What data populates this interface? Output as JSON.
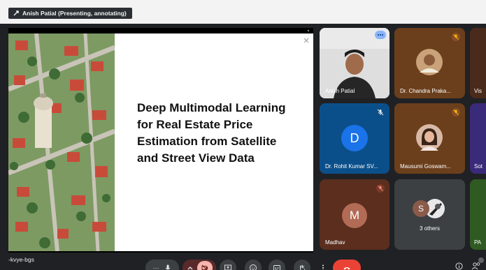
{
  "presenter": {
    "label": "Anish Patial (Presenting, annotating)"
  },
  "slide": {
    "title_lines": [
      "Deep Multimodal Learning",
      "for Real Estate Price",
      "Estimation from Satellite",
      "and Street View Data"
    ]
  },
  "participants": [
    {
      "name": "Anish Patial",
      "muted": false
    },
    {
      "name": "Dr. Chandra Praka...",
      "muted": true
    },
    {
      "name": "Vis",
      "muted": false
    },
    {
      "name": "Dr. Rohit Kumar SV...",
      "initial": "D",
      "muted": true
    },
    {
      "name": "Mausumi Goswam...",
      "muted": true
    },
    {
      "name": "Sot",
      "muted": false
    },
    {
      "name": "Madhav",
      "initial": "M",
      "muted": true
    },
    {
      "name": "3 others",
      "initial": "S"
    },
    {
      "name": "PA",
      "muted": false
    }
  ],
  "meeting": {
    "code": "-kvye-bgs"
  },
  "colors": {
    "end_call": "#ea4335",
    "tile_blue": "#0b4f8a",
    "tile_brown": "#5b2e1e",
    "tile_dark": "#3c4043"
  },
  "icons": [
    "present-icon",
    "mic-off-icon",
    "more-icon",
    "mic-icon",
    "chevron-up-icon",
    "camera-off-icon",
    "present-screen-icon",
    "emoji-icon",
    "captions-icon",
    "raise-hand-icon",
    "more-vert-icon",
    "end-call-icon",
    "info-icon",
    "people-icon"
  ]
}
